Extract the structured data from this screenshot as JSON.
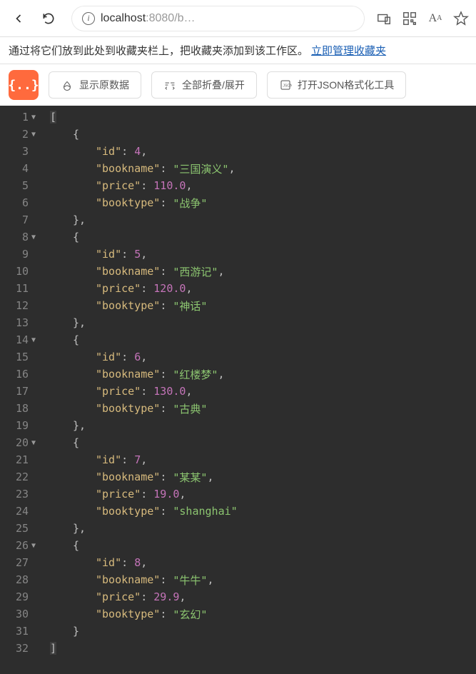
{
  "browser": {
    "url_host": "localhost",
    "url_port": ":8080",
    "url_path": "/b…",
    "font_size_indicator": "A",
    "font_size_small": "A"
  },
  "favorites": {
    "hint": "通过将它们放到此处到收藏夹栏上，把收藏夹添加到该工作区。",
    "manage_link": "立即管理收藏夹"
  },
  "toolbar": {
    "logo_text": "{..}",
    "show_raw": "显示原数据",
    "fold_all": "全部折叠/展开",
    "open_tool": "打开JSON格式化工具"
  },
  "json_data": [
    {
      "id": 4,
      "bookname": "三国演义",
      "price": 110.0,
      "booktype": "战争"
    },
    {
      "id": 5,
      "bookname": "西游记",
      "price": 120.0,
      "booktype": "神话"
    },
    {
      "id": 6,
      "bookname": "红楼梦",
      "price": 130.0,
      "booktype": "古典"
    },
    {
      "id": 7,
      "bookname": "某某",
      "price": 19.0,
      "booktype": "shanghai"
    },
    {
      "id": 8,
      "bookname": "牛牛",
      "price": 29.9,
      "booktype": "玄幻"
    }
  ],
  "editor": {
    "lines": 32,
    "fold_lines": [
      1,
      2,
      8,
      14,
      20,
      26
    ]
  }
}
